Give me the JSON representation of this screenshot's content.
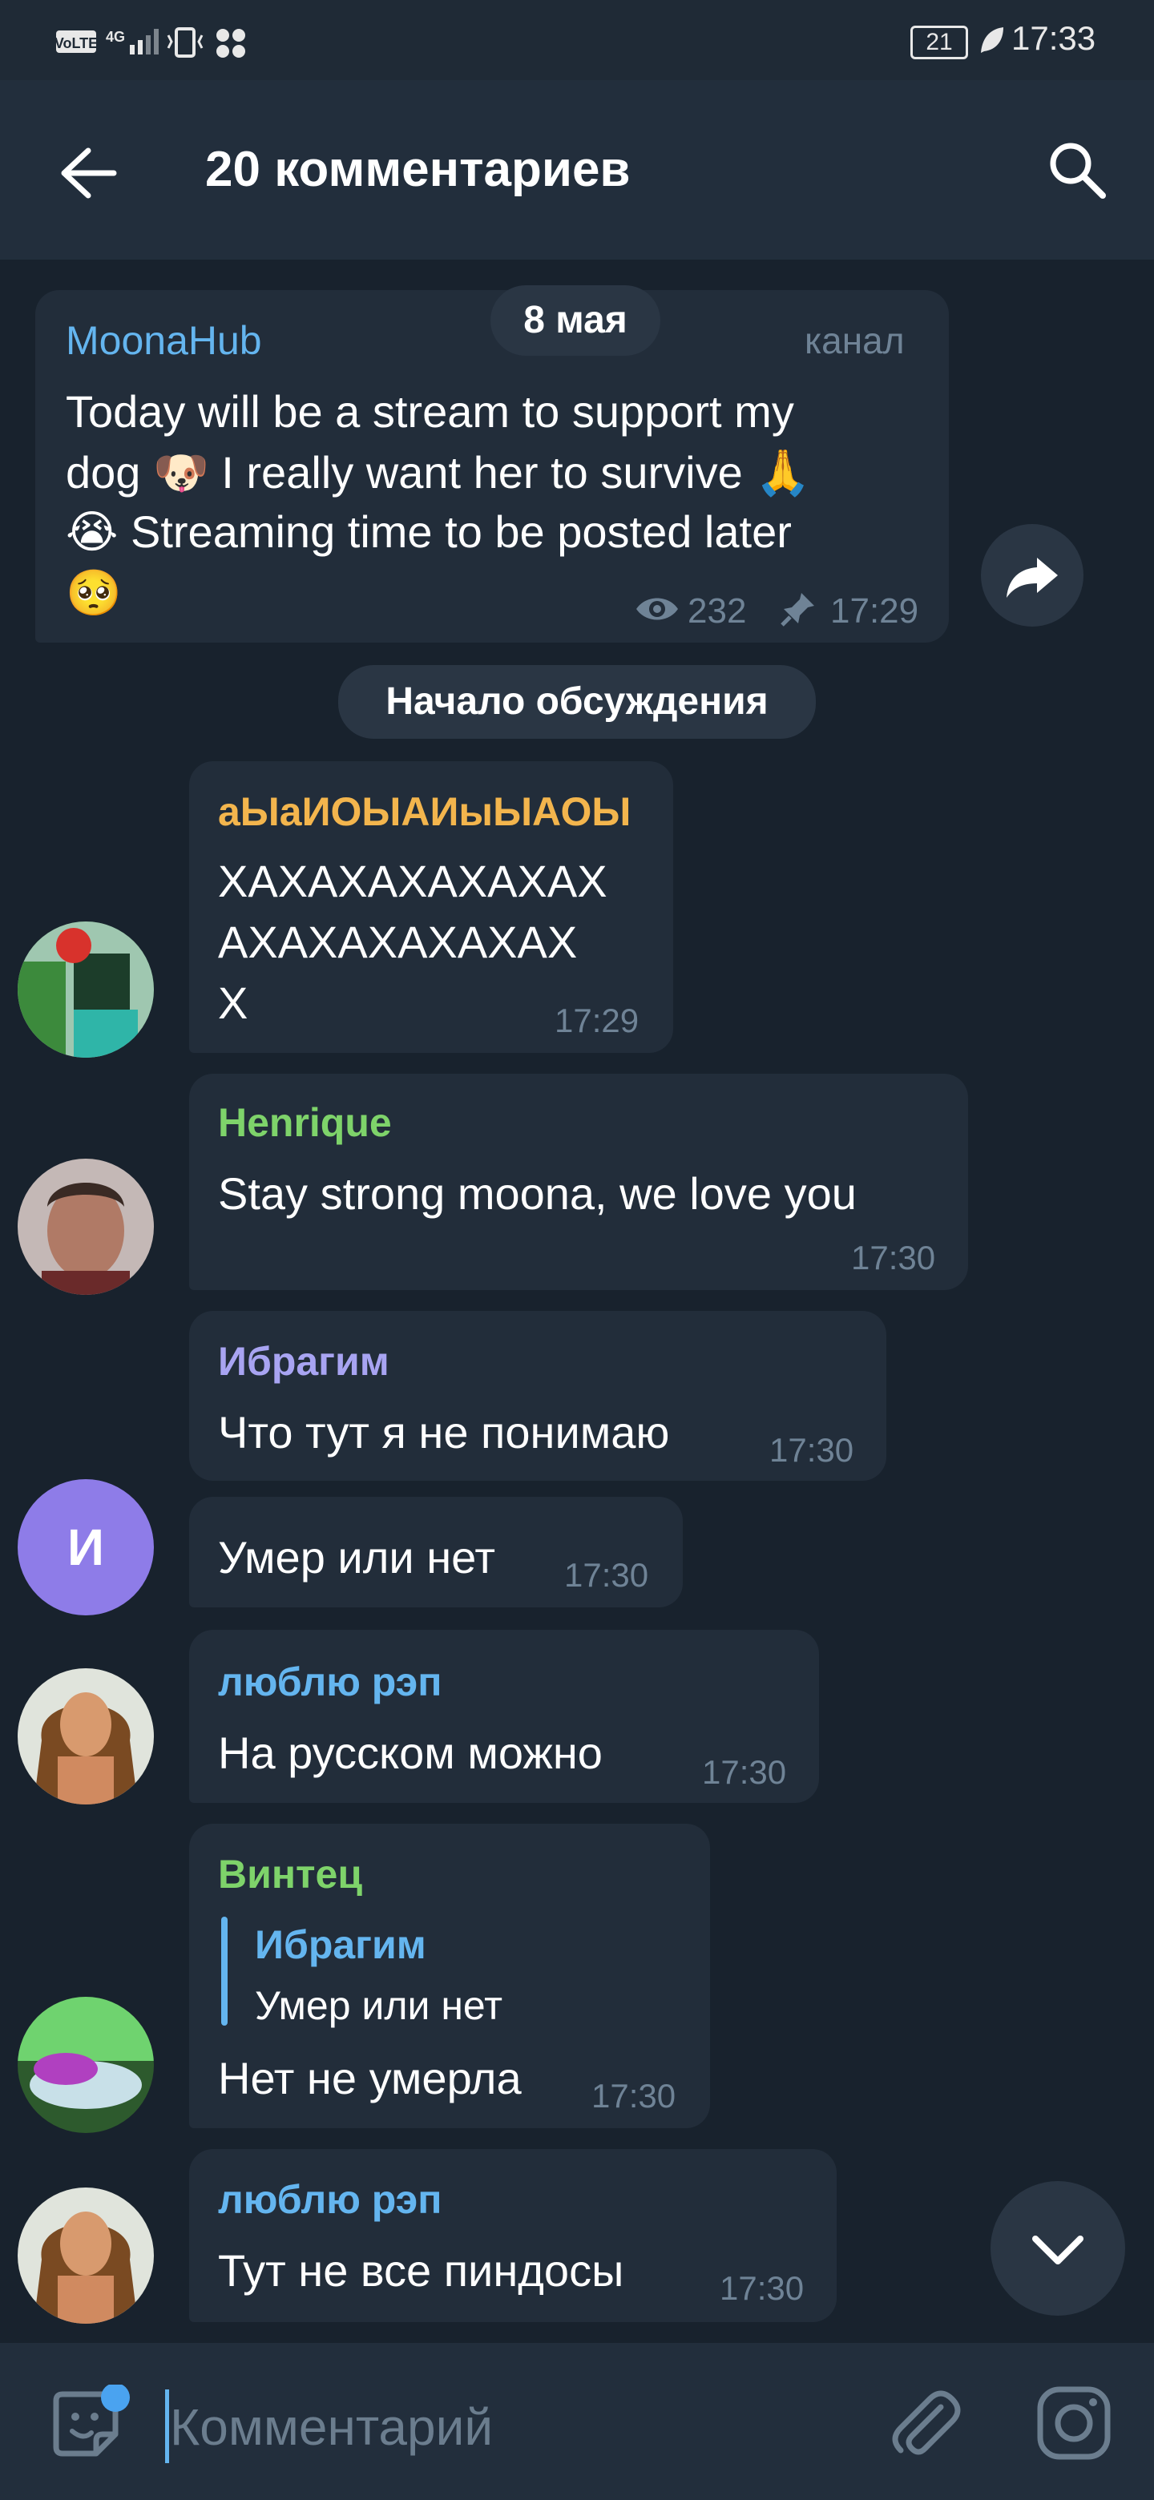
{
  "status_bar": {
    "network": "VoLTE 4G",
    "battery": "21",
    "time": "17:33"
  },
  "header": {
    "title": "20 комментариев"
  },
  "date_badge": "8 мая",
  "channel_post": {
    "author": "MoonaHub",
    "badge": "канал",
    "lines": [
      "Today will be a stream to support my",
      "dog 🐶 I really want her to survive 🙏",
      "😭 Streaming time to be posted later",
      "🥺"
    ],
    "views": "232",
    "time": "17:29"
  },
  "discussion_badge": "Начало обсуждения",
  "messages": [
    {
      "author": "аЫаИОЫАИыЫАОЫ",
      "lines": [
        "ХАХАХАХАХАХАХ",
        "АХАХАХАХАХАХ",
        "Х"
      ],
      "time": "17:29"
    },
    {
      "author": "Henrique",
      "lines": [
        "Stay strong moona, we love you"
      ],
      "time": "17:30"
    },
    {
      "author": "Ибрагим",
      "lines": [
        "Что тут я не понимаю"
      ],
      "time": "17:30"
    },
    {
      "lines": [
        "Умер или нет"
      ],
      "time": "17:30",
      "avatar_letter": "И"
    },
    {
      "author": "люблю рэп",
      "lines": [
        "На русском можно"
      ],
      "time": "17:30"
    },
    {
      "author": "Винтец",
      "reply": {
        "author": "Ибрагим",
        "text": "Умер или нет"
      },
      "lines": [
        "Нет не умерла"
      ],
      "time": "17:30"
    },
    {
      "author": "люблю рэп",
      "lines": [
        "Тут не все пиндосы"
      ],
      "time": "17:30"
    }
  ],
  "input": {
    "placeholder": "Комментарий"
  },
  "colors": {
    "background": "#18222d",
    "bubble": "#222d3a",
    "header": "#222e3c",
    "accent": "#64b5ef"
  },
  "icons": [
    "back-arrow-icon",
    "search-icon",
    "forward-icon",
    "eye-icon",
    "pin-icon",
    "chevron-down-icon",
    "sticker-icon",
    "paperclip-icon",
    "camera-icon"
  ]
}
